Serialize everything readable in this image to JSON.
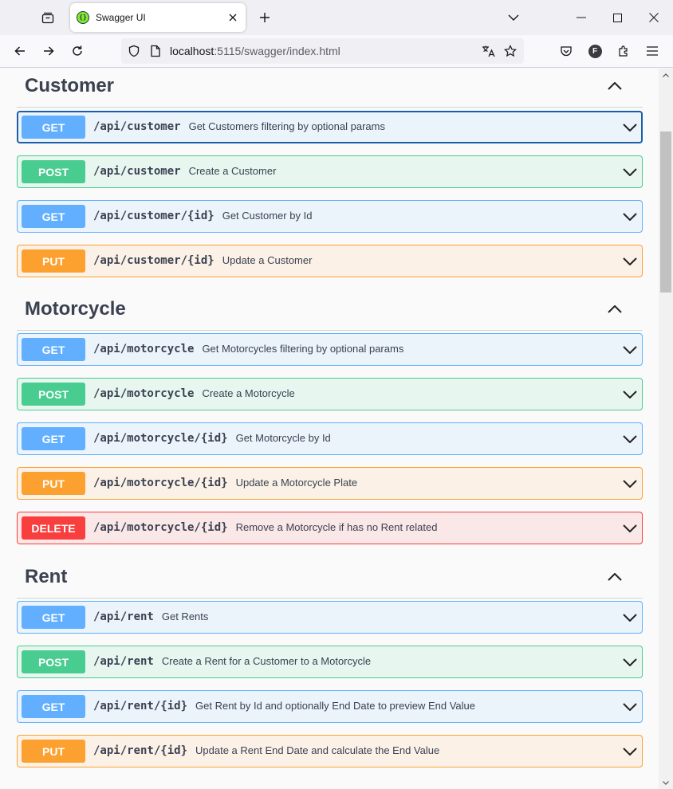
{
  "browser": {
    "tab_title": "Swagger UI",
    "url_host": "localhost",
    "url_rest": ":5115/swagger/index.html",
    "extension_letter": "F"
  },
  "sections": [
    {
      "title": "Customer",
      "operations": [
        {
          "method": "GET",
          "path": "/api/customer",
          "summary": "Get Customers filtering by optional params"
        },
        {
          "method": "POST",
          "path": "/api/customer",
          "summary": "Create a Customer"
        },
        {
          "method": "GET",
          "path": "/api/customer/{id}",
          "summary": "Get Customer by Id"
        },
        {
          "method": "PUT",
          "path": "/api/customer/{id}",
          "summary": "Update a Customer"
        }
      ]
    },
    {
      "title": "Motorcycle",
      "operations": [
        {
          "method": "GET",
          "path": "/api/motorcycle",
          "summary": "Get Motorcycles filtering by optional params"
        },
        {
          "method": "POST",
          "path": "/api/motorcycle",
          "summary": "Create a Motorcycle"
        },
        {
          "method": "GET",
          "path": "/api/motorcycle/{id}",
          "summary": "Get Motorcycle by Id"
        },
        {
          "method": "PUT",
          "path": "/api/motorcycle/{id}",
          "summary": "Update a Motorcycle Plate"
        },
        {
          "method": "DELETE",
          "path": "/api/motorcycle/{id}",
          "summary": "Remove a Motorcycle if has no Rent related"
        }
      ]
    },
    {
      "title": "Rent",
      "operations": [
        {
          "method": "GET",
          "path": "/api/rent",
          "summary": "Get Rents"
        },
        {
          "method": "POST",
          "path": "/api/rent",
          "summary": "Create a Rent for a Customer to a Motorcycle"
        },
        {
          "method": "GET",
          "path": "/api/rent/{id}",
          "summary": "Get Rent by Id and optionally End Date to preview End Value"
        },
        {
          "method": "PUT",
          "path": "/api/rent/{id}",
          "summary": "Update a Rent End Date and calculate the End Value"
        }
      ]
    }
  ],
  "method_colors": {
    "GET": "#61affe",
    "POST": "#49cc90",
    "PUT": "#fca130",
    "DELETE": "#f93e3e"
  }
}
